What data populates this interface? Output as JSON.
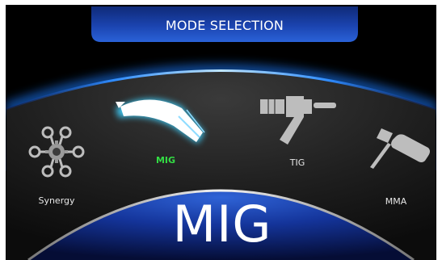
{
  "header": {
    "title": "MODE SELECTION"
  },
  "modes": [
    {
      "label": "Synergy",
      "icon": "synergy-icon",
      "active": false
    },
    {
      "label": "MIG",
      "icon": "mig-torch-icon",
      "active": true
    },
    {
      "label": "TIG",
      "icon": "tig-torch-icon",
      "active": false
    },
    {
      "label": "MMA",
      "icon": "mma-electrode-holder-icon",
      "active": false
    }
  ],
  "selected": {
    "label": "MIG"
  },
  "colors": {
    "accent_blue": "#1f7dff",
    "header_blue": "#1b3d9c",
    "active_green": "#33dd44",
    "icon_gray": "#bdbdbd",
    "background": "#000000"
  }
}
